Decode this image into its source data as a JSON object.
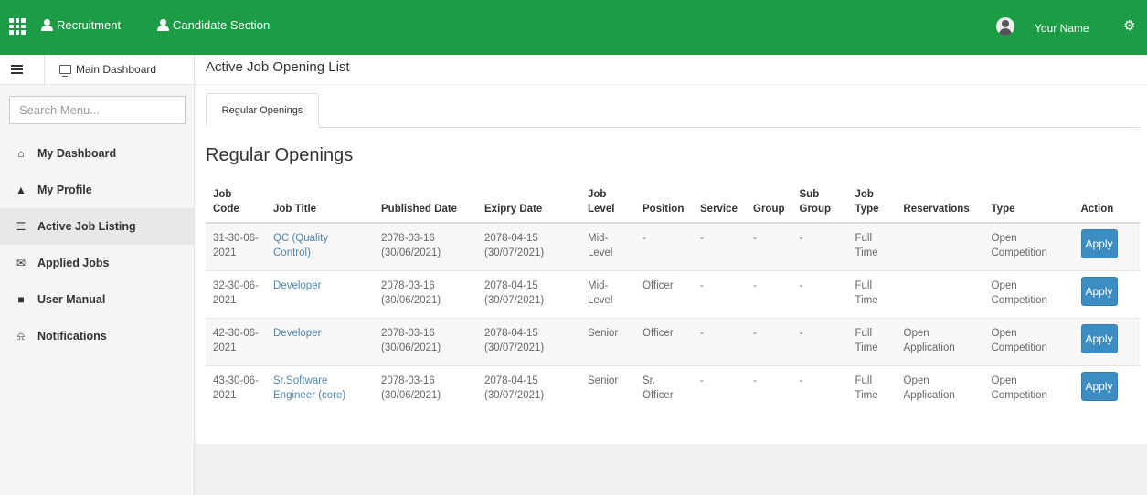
{
  "topbar": {
    "nav": [
      {
        "label": "Recruitment",
        "icon": "user-icon"
      },
      {
        "label": "Candidate Section",
        "icon": "user-icon"
      }
    ],
    "user_name": "Your Name",
    "gear_glyph": "⚙",
    "bg_color": "#1d9c46"
  },
  "sidebar": {
    "main_dashboard": "Main Dashboard",
    "search_placeholder": "Search Menu...",
    "items": [
      {
        "label": "My Dashboard",
        "icon": "home-icon",
        "glyph": "🏠"
      },
      {
        "label": "My Profile",
        "icon": "user-icon",
        "glyph": "👤"
      },
      {
        "label": "Active Job Listing",
        "icon": "list-icon",
        "glyph": "☰"
      },
      {
        "label": "Applied Jobs",
        "icon": "envelope-icon",
        "glyph": "✉"
      },
      {
        "label": "User Manual",
        "icon": "folder-icon",
        "glyph": "📂"
      },
      {
        "label": "Notifications",
        "icon": "bell-icon",
        "glyph": "🔔"
      }
    ]
  },
  "main": {
    "page_title": "Active Job Opening List",
    "tab_label": "Regular Openings",
    "section_title": "Regular Openings",
    "table": {
      "headers": [
        "Job Code",
        "Job Title",
        "Published Date",
        "Exipry Date",
        "Job Level",
        "Position",
        "Service",
        "Group",
        "Sub Group",
        "Job Type",
        "Reservations",
        "Type",
        "Action"
      ],
      "rows": [
        [
          "31-30-06-2021",
          "QC (Quality Control)",
          "2078-03-16 (30/06/2021)",
          "2078-04-15 (30/07/2021)",
          "Mid-Level",
          "-",
          "-",
          "-",
          "-",
          "Full Time",
          "",
          "Open Competition",
          "Apply"
        ],
        [
          "32-30-06-2021",
          "Developer",
          "2078-03-16 (30/06/2021)",
          "2078-04-15 (30/07/2021)",
          "Mid-Level",
          "Officer",
          "-",
          "-",
          "-",
          "Full Time",
          "",
          "Open Competition",
          "Apply"
        ],
        [
          "42-30-06-2021",
          "Developer",
          "2078-03-16 (30/06/2021)",
          "2078-04-15 (30/07/2021)",
          "Senior",
          "Officer",
          "-",
          "-",
          "-",
          "Full Time",
          "Open Application",
          "Open Competition",
          "Apply"
        ],
        [
          "43-30-06-2021",
          "Sr.Software Engineer (core)",
          "2078-03-16 (30/06/2021)",
          "2078-04-15 (30/07/2021)",
          "Senior",
          "Sr. Officer",
          "-",
          "-",
          "-",
          "Full Time",
          "Open Application",
          "Open Competition",
          "Apply"
        ]
      ]
    }
  }
}
